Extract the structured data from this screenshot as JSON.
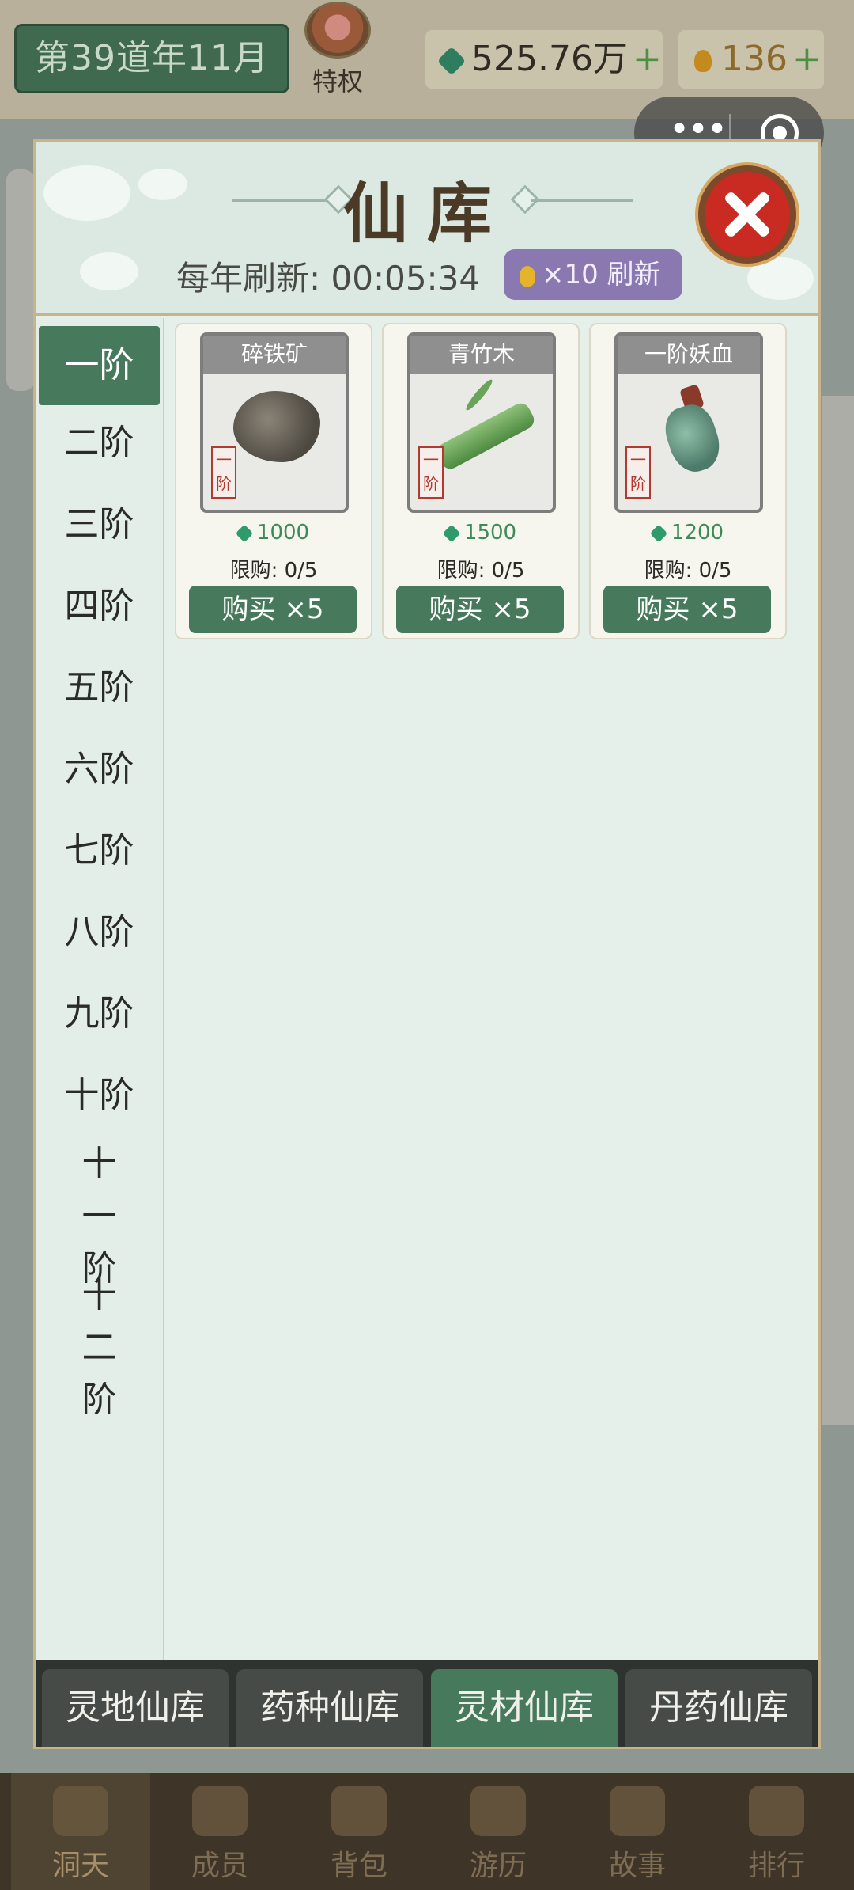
{
  "topbar": {
    "year_text": "第39道年11月",
    "privilege_label": "特权",
    "jade_amount": "525.76万",
    "gold_amount": "136",
    "plus": "+"
  },
  "capsule": {
    "more": "•••"
  },
  "modal": {
    "title": "仙库",
    "refresh_label": "每年刷新: 00:05:34",
    "refresh_button": "×10 刷新"
  },
  "tiers": [
    "一阶",
    "二阶",
    "三阶",
    "四阶",
    "五阶",
    "六阶",
    "七阶",
    "八阶",
    "九阶",
    "十阶",
    "十一阶",
    "十二阶"
  ],
  "active_tier": "一阶",
  "items": [
    {
      "name": "碎铁矿",
      "tag": "一阶",
      "price": "1000",
      "limit": "限购: 0/5",
      "buy": "购买 ×5"
    },
    {
      "name": "青竹木",
      "tag": "一阶",
      "price": "1500",
      "limit": "限购: 0/5",
      "buy": "购买 ×5"
    },
    {
      "name": "一阶妖血",
      "tag": "一阶",
      "price": "1200",
      "limit": "限购: 0/5",
      "buy": "购买 ×5"
    }
  ],
  "tabs": [
    "灵地仙库",
    "药种仙库",
    "灵材仙库",
    "丹药仙库"
  ],
  "active_tab": "灵材仙库",
  "nav": [
    "洞天",
    "成员",
    "背包",
    "游历",
    "故事",
    "排行"
  ],
  "active_nav": "洞天",
  "colors": {
    "accent_green": "#477a5c",
    "close_red": "#c92a22",
    "refresh_purple": "#8a78b0"
  }
}
